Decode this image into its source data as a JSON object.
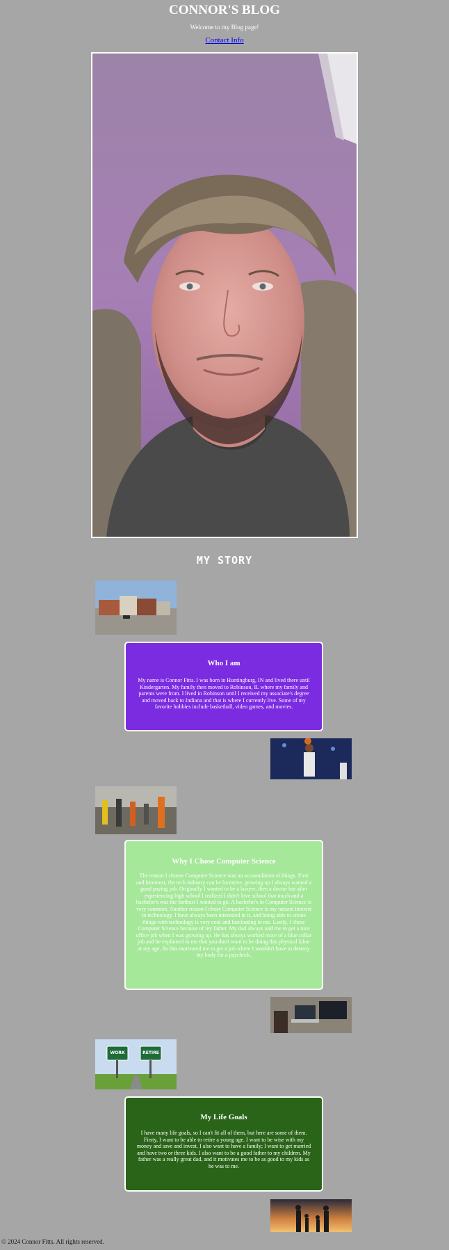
{
  "header": {
    "title": "CONNOR'S BLOG",
    "tagline": "Welcome to my Blog page!",
    "contact_link": "Contact Info"
  },
  "story": {
    "heading": "MY STORY",
    "sections": [
      {
        "title": "Who I am",
        "text": "My name is Connor Fitts. I was born in Huntingburg, IN and lived there until Kindergarten. My family then moved to Robinson, IL where my family and parents were from. I lived in Robinson until I received my associate's degree and moved back to Indiana and that is where I currently live. Some of my favorite hobbies include basketball, video games, and movies.",
        "color": "#7b2be0"
      },
      {
        "title": "Why I Chose Computer Science",
        "text": "The reason I choose Computer Science was an accumulation of things. First and foremost, the tech industry can be lucrative, growing up I always wanted a good paying job. Originally I wanted to be a lawyer, then a doctor but after experiencing high school I realized I didn't love school that much and a bachelor's was the furthest I wanted to go. A bachelor's in Computer Science is very common. Another reason I chose Computer Science is my natural interest in technology. I have always been interested in it, and being able to create things with technology is very cool and fascinating to me. Lastly, I chose Computer Science because of my father. My dad always told me to get a nice office job when I was growing up. He has always worked more of a blue collar job and he explained to me that you don't want to be doing this physical labor at my age. So this motivated me to get a job where I wouldn't have to destroy my body for a paycheck.",
        "color": "#a6e89a"
      },
      {
        "title": "My Life Goals",
        "text": "I have many life goals, so I can't fit all of them, but here are some of them. Firsty, I want to be able to retire a young age. I want to be wise with my money and save and invest. I also want to have a family; I want to get married and have two or three kids. I also want to be a good father to my children. My father was a really great dad, and it motivates me to be as good to my kids as he was to me.",
        "color": "#2a6419"
      }
    ],
    "sign_labels": {
      "work": "WORK",
      "retire": "RETIRE"
    }
  },
  "footer": {
    "text": "© 2024 Connor Fitts. All rights reserved."
  }
}
